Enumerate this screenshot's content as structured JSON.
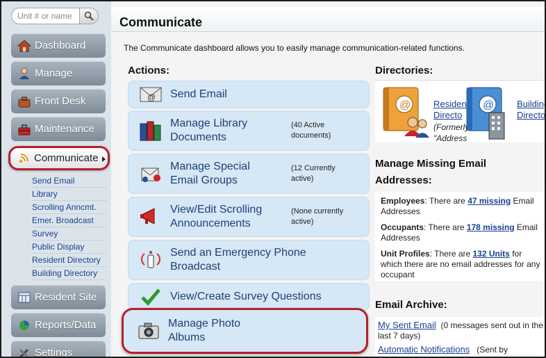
{
  "search": {
    "placeholder": "Unit # or name"
  },
  "nav": [
    {
      "label": "Dashboard",
      "icon": "house-icon"
    },
    {
      "label": "Manage",
      "icon": "person-icon"
    },
    {
      "label": "Front Desk",
      "icon": "briefcase-icon"
    },
    {
      "label": "Maintenance",
      "icon": "toolbox-icon"
    },
    {
      "label": "Communicate",
      "icon": "broadcast-icon"
    },
    {
      "label": "Resident Site",
      "icon": "grid-icon"
    },
    {
      "label": "Reports/Data",
      "icon": "pie-chart-icon"
    },
    {
      "label": "Settings",
      "icon": "wrench-icon"
    }
  ],
  "subnav": [
    "Send Email",
    "Library",
    "Scrolling Anncmt.",
    "Emer. Broadcast",
    "Survey",
    "Public Display",
    "Resident Directory",
    "Building Directory"
  ],
  "page": {
    "title": "Communicate",
    "intro": "The Communicate dashboard allows you to easily manage communication-related functions."
  },
  "actions": {
    "title": "Actions:",
    "items": [
      {
        "label_1": "Send Email",
        "label_2": "",
        "note_1": "",
        "note_2": ""
      },
      {
        "label_1": "Manage Library",
        "label_2": "Documents",
        "note_1": "(40 Active",
        "note_2": "documents)"
      },
      {
        "label_1": "Manage Special",
        "label_2": "Email Groups",
        "note_1": "(12 Currently",
        "note_2": "active)"
      },
      {
        "label_1": "View/Edit Scrolling",
        "label_2": "Announcements",
        "note_1": "(None currently",
        "note_2": "active)"
      },
      {
        "label_1": "Send an Emergency Phone",
        "label_2": "Broadcast",
        "note_1": "",
        "note_2": ""
      },
      {
        "label_1": "View/Create Survey Questions",
        "label_2": "",
        "note_1": "",
        "note_2": ""
      },
      {
        "label_1": "Manage Photo",
        "label_2": "Albums",
        "note_1": "",
        "note_2": ""
      }
    ]
  },
  "directories": {
    "title": "Directories:",
    "resident_1": "Residen",
    "resident_2": "Directo",
    "formerly_1": "(Formerly",
    "formerly_2": "\"Address",
    "building_1": "Building",
    "building_2": "Directo"
  },
  "missing": {
    "title_1": "Manage Missing Email",
    "title_2": "Addresses:",
    "employees_label": "Employees",
    "employees_pre": ": There are ",
    "employees_link": "47 missing",
    "employees_post": " Email Addresses",
    "occupants_label": "Occupants",
    "occupants_pre": ": There are ",
    "occupants_link": "178 missing",
    "occupants_post": " Email Addresses",
    "units_label": "Unit Profiles",
    "units_pre": ": There are ",
    "units_link": "132 Units",
    "units_post": " for which there are no email addresses for any occupant"
  },
  "archive": {
    "title": "Email Archive:",
    "sent_link": "My Sent Email",
    "sent_note": "(0  messages sent out in the last 7 days)",
    "auto_link": "Automatic Notifications",
    "auto_note": "(Sent by"
  },
  "colors": {
    "accent_red": "#b5202a",
    "link_blue": "#1a3f91",
    "action_bg": "#d6e7f5",
    "nav_gray": "#8f9ba6"
  }
}
